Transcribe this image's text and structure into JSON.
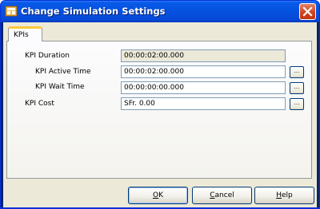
{
  "window": {
    "title": "Change Simulation Settings"
  },
  "tabs": [
    {
      "label": "KPIs",
      "selected": true
    }
  ],
  "form": {
    "kpi_duration": {
      "label": "KPI Duration",
      "value": "00:00:02:00.000"
    },
    "kpi_active_time": {
      "label": "KPI Active Time",
      "value": "00:00:02:00.000",
      "button": "..."
    },
    "kpi_wait_time": {
      "label": "KPI Wait Time",
      "value": "00:00:00:00.000",
      "button": "..."
    },
    "kpi_cost": {
      "label": "KPI Cost",
      "value": "SFr. 0.00",
      "button": "..."
    }
  },
  "buttons": {
    "ok_mnemonic": "O",
    "ok_rest": "K",
    "cancel_mnemonic": "C",
    "cancel_rest": "ancel",
    "help_mnemonic": "H",
    "help_rest": "elp"
  },
  "colors": {
    "titlebar": "#0553e1",
    "dialog_bg": "#ece9d8",
    "tab_highlight": "#ffc83c",
    "close_button": "#d0451f"
  }
}
